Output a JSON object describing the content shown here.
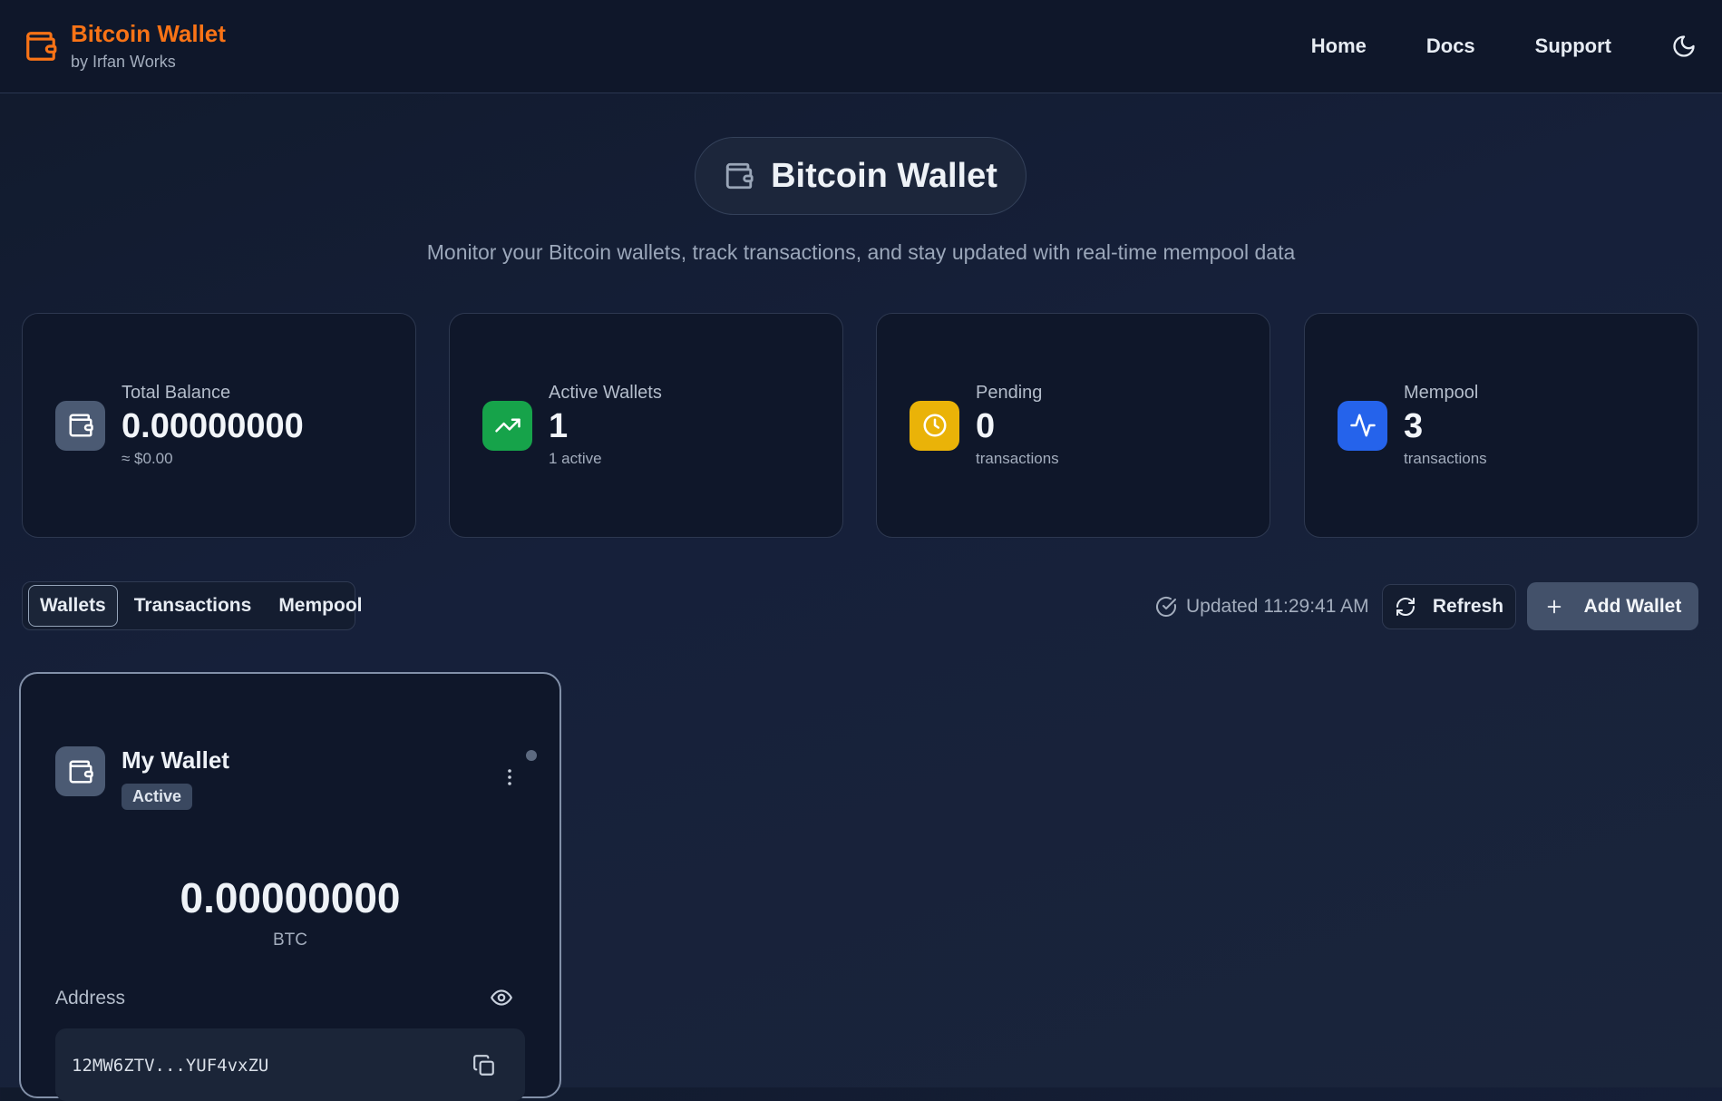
{
  "header": {
    "brand_title": "Bitcoin Wallet",
    "brand_subtitle": "by Irfan Works",
    "brand_color": "#f97316",
    "nav": [
      {
        "label": "Home"
      },
      {
        "label": "Docs"
      },
      {
        "label": "Support"
      }
    ],
    "theme_icon": "moon-icon"
  },
  "hero": {
    "title": "Bitcoin Wallet",
    "subtitle": "Monitor your Bitcoin wallets, track transactions, and stay updated with real-time mempool data"
  },
  "stats": [
    {
      "label": "Total Balance",
      "value": "0.00000000",
      "sub": "≈ $0.00",
      "icon": "wallet-icon",
      "color": "#4b5a73"
    },
    {
      "label": "Active Wallets",
      "value": "1",
      "sub": "1 active",
      "icon": "trending-up-icon",
      "color": "#16a34a"
    },
    {
      "label": "Pending",
      "value": "0",
      "sub": "transactions",
      "icon": "clock-icon",
      "color": "#eab308"
    },
    {
      "label": "Mempool",
      "value": "3",
      "sub": "transactions",
      "icon": "activity-icon",
      "color": "#2563eb"
    }
  ],
  "tabs": [
    {
      "label": "Wallets",
      "active": true
    },
    {
      "label": "Transactions",
      "active": false
    },
    {
      "label": "Mempool",
      "active": false
    }
  ],
  "toolbar": {
    "updated_text": "Updated 11:29:41 AM",
    "refresh_label": "Refresh",
    "add_wallet_label": "Add Wallet"
  },
  "wallet": {
    "name": "My Wallet",
    "status": "Active",
    "balance": "0.00000000",
    "unit": "BTC",
    "address_label": "Address",
    "address": "12MW6ZTV...YUF4vxZU"
  }
}
